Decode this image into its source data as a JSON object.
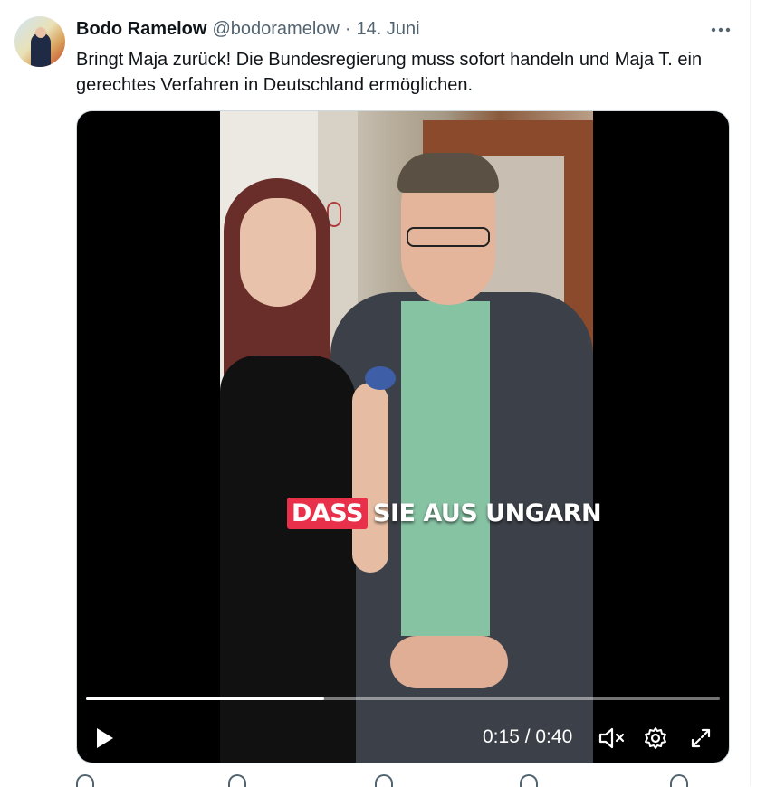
{
  "tweet": {
    "author_name": "Bodo Ramelow",
    "handle": "@bodoramelow",
    "separator": "·",
    "date": "14. Juni",
    "text": "Bringt Maja zurück! Die Bundesregierung muss sofort handeln und Maja T. ein gerechtes Verfahren in Deutschland ermöglichen."
  },
  "video": {
    "caption_highlight": "DASS",
    "caption_rest": "SIE AUS UNGARN",
    "time_display": "0:15 / 0:40",
    "progress_fraction": 0.375,
    "caption_highlight_color": "#e8304a"
  },
  "icons": {
    "more": "more-horizontal-icon",
    "play": "play-icon",
    "mute": "volume-muted-icon",
    "settings": "gear-icon",
    "fullscreen": "fullscreen-icon"
  },
  "colors": {
    "text_primary": "#0f1419",
    "text_secondary": "#536471"
  }
}
